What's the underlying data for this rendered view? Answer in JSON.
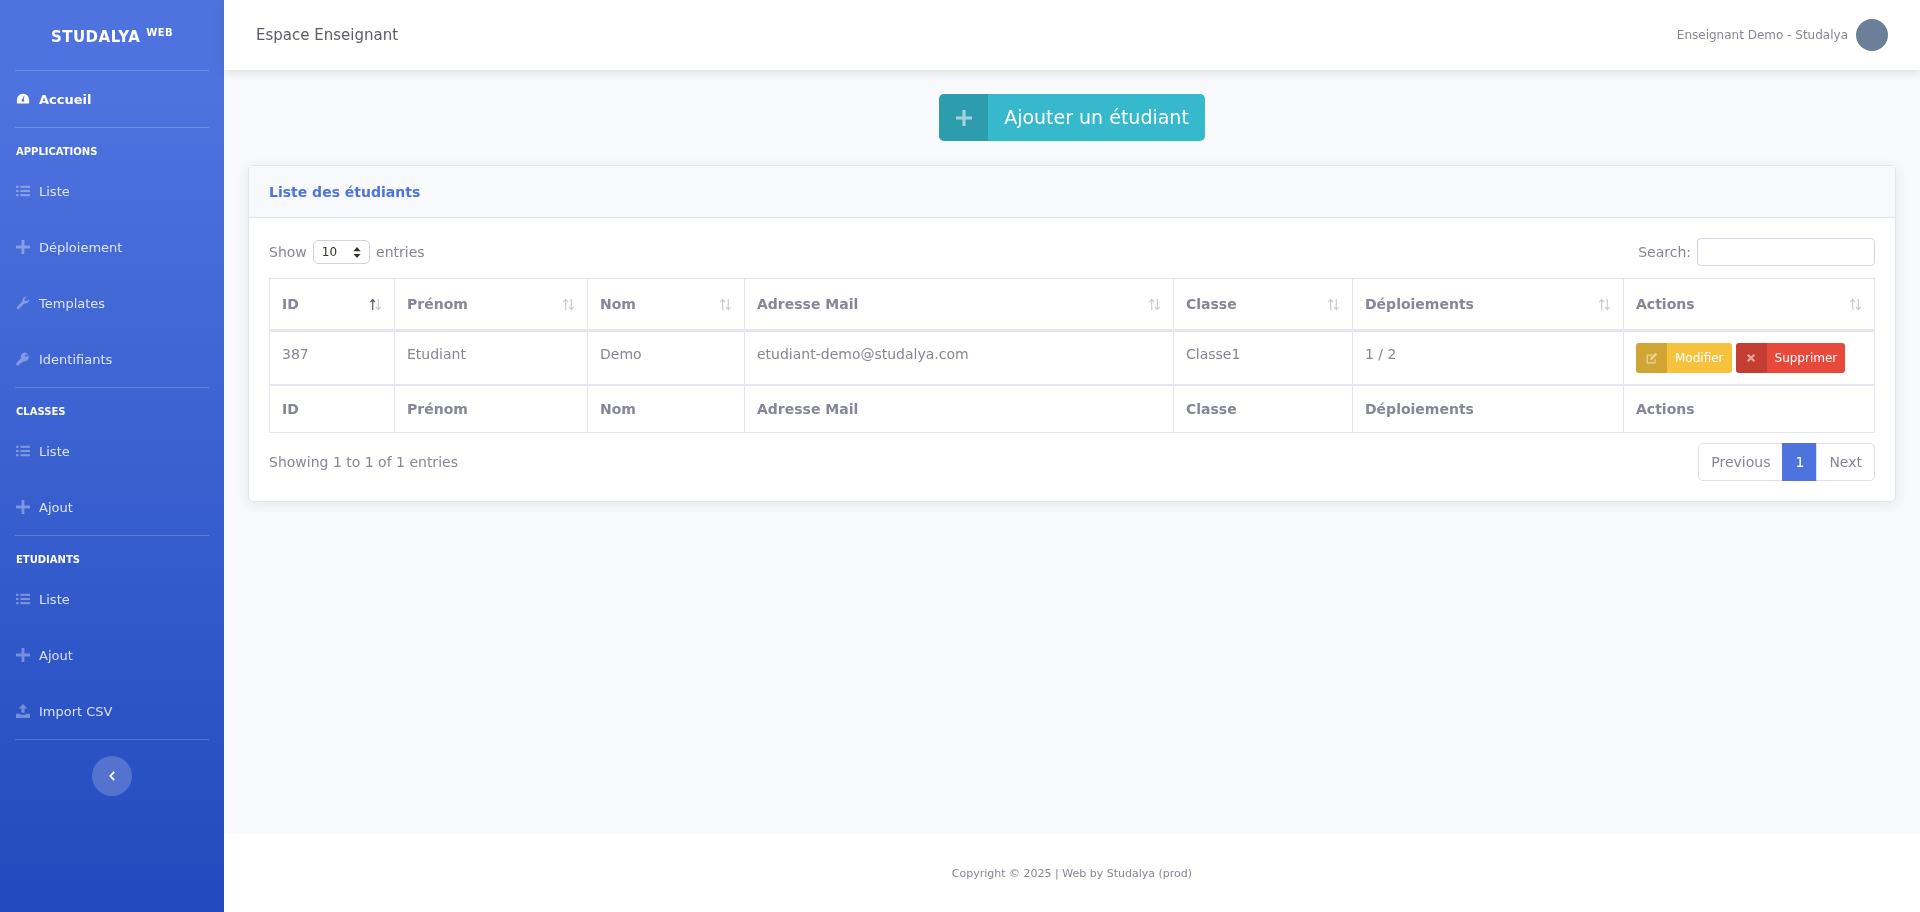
{
  "sidebar": {
    "brand": "STUDALYA",
    "brand_sup": "WEB",
    "sections": [
      {
        "items": [
          {
            "label": "Accueil",
            "kind": "gauge",
            "selected": true
          }
        ]
      },
      {
        "heading": "APPLICATIONS",
        "items": [
          {
            "label": "Liste",
            "kind": "list",
            "selected": false
          },
          {
            "label": "Déploiement",
            "kind": "plus",
            "selected": false
          },
          {
            "label": "Templates",
            "kind": "wrench",
            "selected": false
          },
          {
            "label": "Identifiants",
            "kind": "key",
            "selected": false
          }
        ]
      },
      {
        "heading": "CLASSES",
        "items": [
          {
            "label": "Liste",
            "kind": "list",
            "selected": false
          },
          {
            "label": "Ajout",
            "kind": "plus",
            "selected": false
          }
        ]
      },
      {
        "heading": "ETUDIANTS",
        "items": [
          {
            "label": "Liste",
            "kind": "list",
            "selected": false
          },
          {
            "label": "Ajout",
            "kind": "plus",
            "selected": false
          },
          {
            "label": "Import CSV",
            "kind": "upload",
            "selected": false
          }
        ]
      }
    ]
  },
  "topbar": {
    "title": "Espace Enseignant",
    "user": "Enseignant Demo - Studalya"
  },
  "add_button": "Ajouter un étudiant",
  "card": {
    "title": "Liste des étudiants",
    "length": {
      "before": "Show",
      "value": "10",
      "after": "entries"
    },
    "search_label": "Search:",
    "columns": [
      {
        "label": "ID",
        "sorted": true
      },
      {
        "label": "Prénom",
        "sorted": false
      },
      {
        "label": "Nom",
        "sorted": false
      },
      {
        "label": "Adresse Mail",
        "sorted": false
      },
      {
        "label": "Classe",
        "sorted": false
      },
      {
        "label": "Déploiements",
        "sorted": false
      },
      {
        "label": "Actions",
        "sorted": false
      }
    ],
    "rows": [
      {
        "cells": [
          "387",
          "Etudiant",
          "Demo",
          "etudiant-demo@studalya.com",
          "Classe1",
          "1 / 2"
        ],
        "actions": [
          {
            "label": "Modifier",
            "kind": "edit"
          },
          {
            "label": "Supprimer",
            "kind": "delete"
          }
        ]
      }
    ],
    "footer_columns": [
      "ID",
      "Prénom",
      "Nom",
      "Adresse Mail",
      "Classe",
      "Déploiements",
      "Actions"
    ],
    "info": "Showing 1 to 1 of 1 entries",
    "pagination": [
      {
        "label": "Previous",
        "selected": false
      },
      {
        "label": "1",
        "selected": true
      },
      {
        "label": "Next",
        "selected": false
      }
    ]
  },
  "footer": "Copyright © 2025 | Web by Studalya (prod)"
}
